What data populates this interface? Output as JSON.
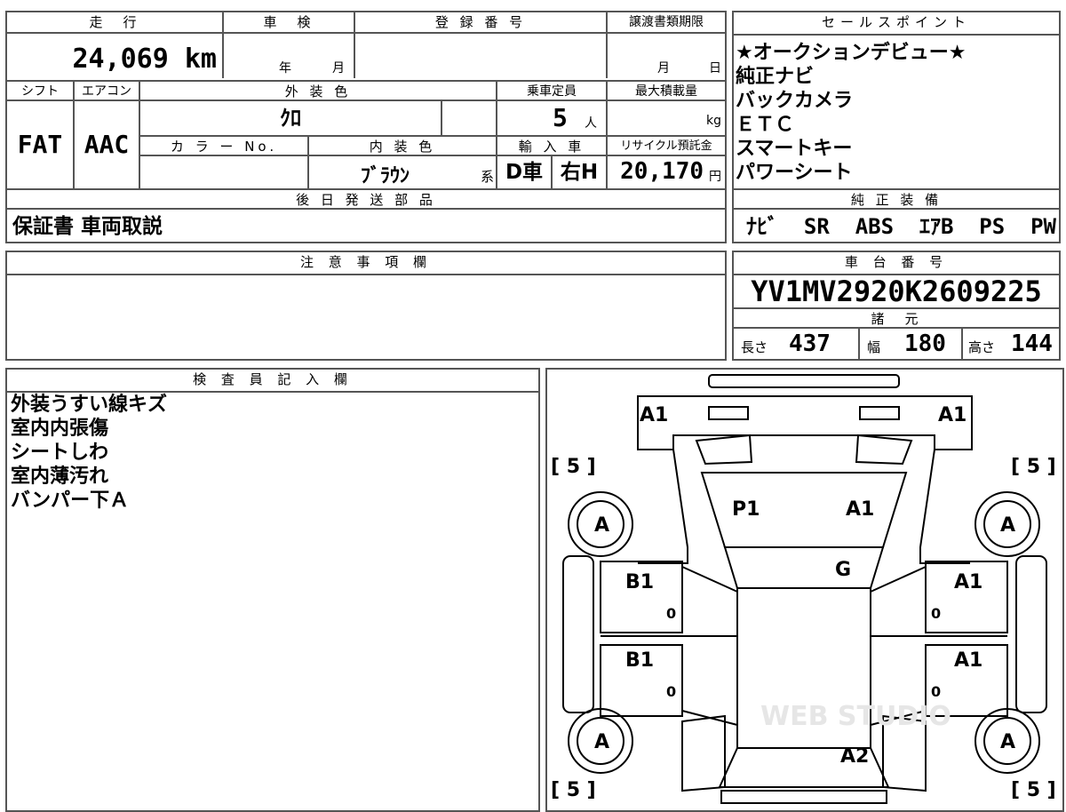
{
  "top_info": {
    "mileage_label": "走　行",
    "mileage_value": "24,069 km",
    "inspection_label": "車　検",
    "inspection_year_unit": "年",
    "inspection_month_unit": "月",
    "registration_label": "登 録 番 号",
    "registration_value": "",
    "transfer_label": "譲渡書類期限",
    "transfer_month_unit": "月",
    "transfer_day_unit": "日"
  },
  "second_row": {
    "shift_label": "シフト",
    "shift_value": "FAT",
    "ac_label": "エアコン",
    "ac_value": "AAC",
    "exterior_color_label": "外 装 色",
    "exterior_color_value": "ｸﾛ",
    "capacity_label": "乗車定員",
    "capacity_value": "5",
    "capacity_unit": "人",
    "max_load_label": "最大積載量",
    "max_load_unit": "kg",
    "color_no_label": "カ ラ ー No.",
    "interior_color_label": "内 装 色",
    "interior_color_value": "ﾌﾞﾗｳﾝ",
    "interior_color_suffix": "系",
    "import_label": "輸 入 車",
    "import_value_1": "D車",
    "import_value_2": "右H",
    "recycle_label": "リサイクル預託金",
    "recycle_value": "20,170",
    "recycle_unit": "円"
  },
  "later_parts": {
    "label": "後 日 発 送 部 品",
    "value": "保証書 車両取説"
  },
  "sales_points": {
    "label": "セールスポイント",
    "items": [
      "★オークションデビュー★",
      "純正ナビ",
      "バックカメラ",
      "ＥＴＣ",
      "スマートキー",
      "パワーシート"
    ]
  },
  "genuine_equipment": {
    "label": "純 正 装 備",
    "value": "ﾅﾋﾞ  SR  ABS  ｴｱB  PS  PW"
  },
  "notes": {
    "label": "注 意 事 項 欄",
    "value": ""
  },
  "chassis": {
    "label": "車 台 番 号",
    "value": "YV1MV2920K2609225"
  },
  "specs": {
    "label": "諸　元",
    "length_label": "長さ",
    "length_value": "437",
    "width_label": "幅",
    "width_value": "180",
    "height_label": "高さ",
    "height_value": "144"
  },
  "inspector": {
    "label": "検 査 員 記 入 欄",
    "lines": [
      "外装うすい線キズ",
      "室内内張傷",
      "シートしわ",
      "室内薄汚れ",
      "バンパー下Ａ"
    ]
  },
  "diagram": {
    "marks": {
      "front_left": "A1",
      "front_right": "A1",
      "bracket_tl": "[ 5 ]",
      "bracket_tr": "[ 5 ]",
      "bracket_bl": "[ 5 ]",
      "bracket_br": "[ 5 ]",
      "wheel_fl": "A",
      "wheel_fr": "A",
      "wheel_rl": "A",
      "wheel_rr": "A",
      "hood_left": "P1",
      "hood_right": "A1",
      "windshield": "G",
      "door_fl": "B1",
      "door_rl": "B1",
      "door_fr": "A1",
      "door_rr": "A1",
      "rear_center": "A2",
      "zero_1": "0",
      "zero_2": "0",
      "zero_3": "0",
      "zero_4": "0"
    },
    "watermark": "WEB STUDIO"
  }
}
